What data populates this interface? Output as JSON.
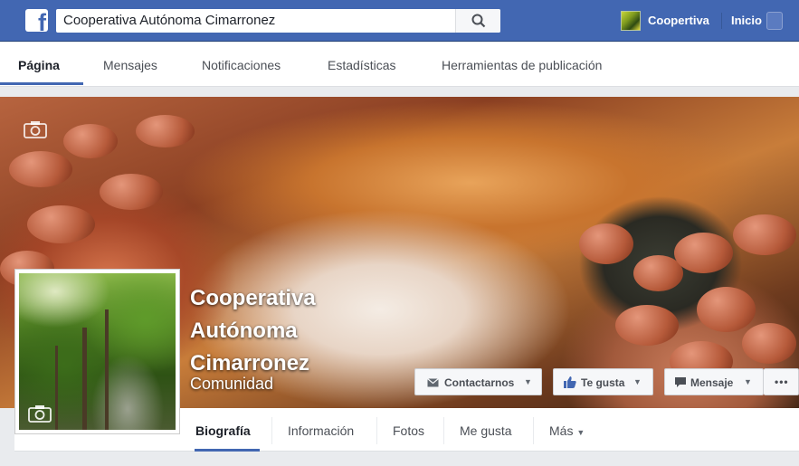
{
  "topbar": {
    "search_value": "Cooperativa Autónoma Cimarronez",
    "profile_name": "Coopertiva",
    "home_label": "Inicio"
  },
  "page_tabs": [
    "Página",
    "Mensajes",
    "Notificaciones",
    "Estadísticas",
    "Herramientas de publicación"
  ],
  "page": {
    "title": "Cooperativa Autónoma Cimarronez",
    "category": "Comunidad"
  },
  "cover_buttons": {
    "contact": "Contactarnos",
    "like": "Te gusta",
    "message": "Mensaje",
    "more": "•••"
  },
  "timeline_tabs": [
    "Biografía",
    "Información",
    "Fotos",
    "Me gusta",
    "Más"
  ],
  "colors": {
    "brand": "#4267b2",
    "page_bg": "#e9ebee"
  }
}
